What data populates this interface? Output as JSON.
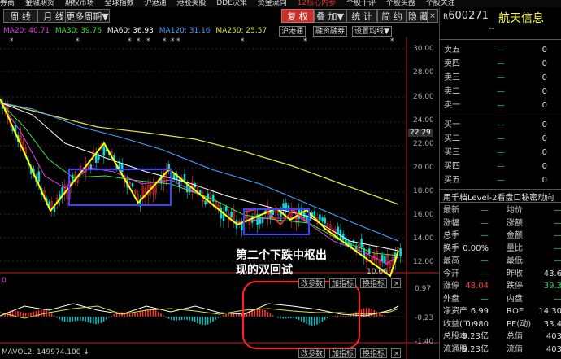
{
  "menu": {
    "items": [
      "券商",
      "金融期货",
      "期权市场",
      "全球指数",
      "沪港通",
      "港股美股",
      "DDE决策",
      "资金流向",
      "12核心内参",
      "个股千评",
      "个股买盘",
      "个股关注"
    ],
    "warning_label": "12核心内参"
  },
  "toolbar": {
    "weekly_label": "周 线",
    "monthly_label": "月 线",
    "more_periods_label": "更多周期▼",
    "restore_label": "复 权",
    "overlay_label": "叠 加▼",
    "stats_label": "统 计",
    "simple_label": "简 约",
    "hide_label": "隐 藏▼",
    "close_label": "×"
  },
  "ma": {
    "ma20": "MA20: 40.71",
    "ma30": "MA30: 39.76",
    "ma60": "MA60: 36.93",
    "ma120": "MA120: 31.16",
    "ma250": "MA250: 25.57",
    "hgt_label": "沪港通",
    "margin_label": "融资融券",
    "settings_label": "设置均线▼",
    "colors": {
      "ma20": "#e040e0",
      "ma30": "#40e040",
      "ma60": "#ffffff",
      "ma120": "#40a0ff",
      "ma250": "#e0e040"
    }
  },
  "price_axis": {
    "ticks": [
      "30.00",
      "28.00",
      "26.00",
      "24.00",
      "22.00",
      "20.00",
      "18.00",
      "16.00",
      "14.00",
      "12.00"
    ],
    "current": "22.29",
    "low_mark": "10.66"
  },
  "annotation": {
    "line1": "第二个下跌中枢出",
    "line2": "现的双回试"
  },
  "macd_panel": {
    "left_label": "0",
    "params_label": "改参数",
    "add_indicator_label": "加指标",
    "switch_indicator_label": "换指标",
    "ticks": [
      "0.97",
      "-0.23",
      "-1.40"
    ]
  },
  "vol_panel": {
    "label": "MAVOL2: 149974.100",
    "arrow": "↓",
    "params_label": "改参数",
    "add_indicator_label": "加指标",
    "switch_indicator_label": "换指标"
  },
  "quote": {
    "code": "600271",
    "name": "航天信息",
    "sub": "--",
    "asks": [
      "卖五",
      "卖四",
      "卖三",
      "卖二",
      "卖一"
    ],
    "bids": [
      "买一",
      "买二",
      "买三",
      "买四",
      "买五"
    ],
    "zero": "0",
    "dash": "—",
    "level2_label": "用千档Level-2看盘口秘密动向",
    "stats": [
      {
        "l1": "最新",
        "v1": "—",
        "l2": "均价",
        "v2": "—"
      },
      {
        "l1": "涨幅",
        "v1": "—",
        "l2": "涨额",
        "v2": "—"
      },
      {
        "l1": "总手",
        "v1": "—",
        "l2": "金额",
        "v2": "—"
      },
      {
        "l1": "换手",
        "v1": "0.00%",
        "l2": "量比",
        "v2": "—"
      },
      {
        "l1": "最高",
        "v1": "—",
        "l2": "最低",
        "v2": "—"
      },
      {
        "l1": "今开",
        "v1": "—",
        "l2": "昨收",
        "v2": "43.6"
      },
      {
        "l1": "涨停",
        "v1": "48.04",
        "l2": "跌停",
        "v2": "39.3"
      },
      {
        "l1": "外盘",
        "v1": "—",
        "l2": "内盘",
        "v2": "—"
      },
      {
        "l1": "净资产",
        "v1": "6.99",
        "l2": "ROE",
        "v2": "14.30"
      },
      {
        "l1": "收益(二)",
        "v1": "0.980",
        "l2": "PE(动)",
        "v2": "33.4"
      },
      {
        "l1": "总股本",
        "v1": "9.23亿",
        "l2": "总值",
        "v2": "403"
      },
      {
        "l1": "流通股",
        "v1": "9.23亿",
        "l2": "流值",
        "v2": "403"
      }
    ]
  }
}
